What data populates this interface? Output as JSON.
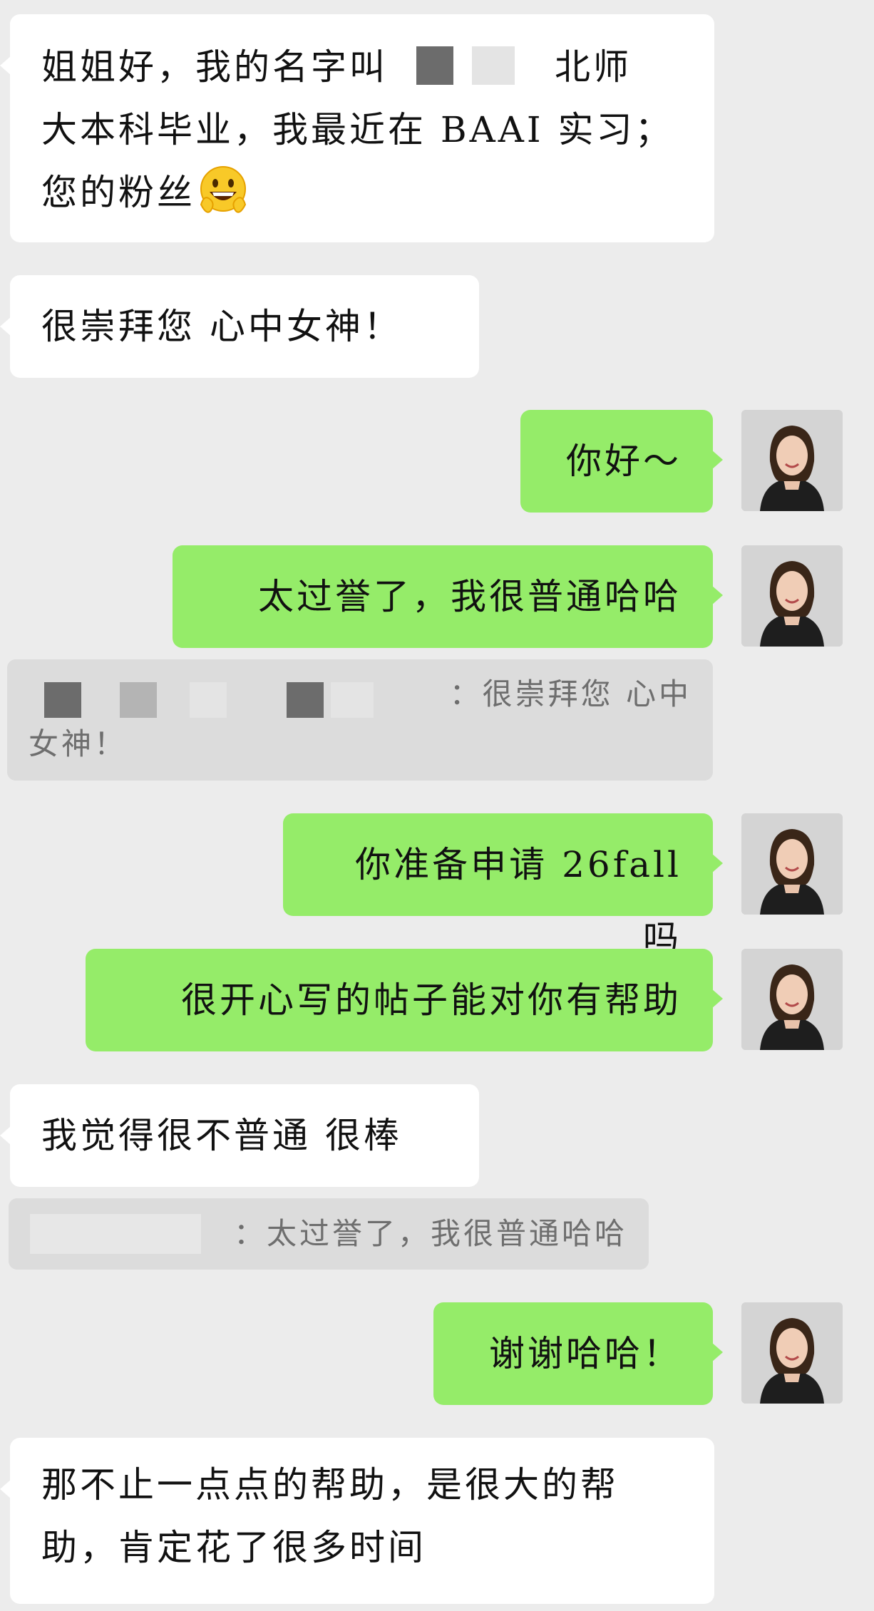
{
  "chat": {
    "messages": [
      {
        "side": "in",
        "line1_before": "姐姐好，我的名字叫",
        "line1_after": "北师",
        "line2": "大本科毕业，我最近在 BAAI 实习；",
        "line3": "您的粉丝",
        "emoji": "grinning-face-peace-hands-emoji"
      },
      {
        "side": "in",
        "text": "很崇拜您 心中女神！"
      },
      {
        "side": "out",
        "text": "你好～"
      },
      {
        "side": "out",
        "text": "太过誉了，我很普通哈哈"
      },
      {
        "side": "quote",
        "text_line1": "：很崇拜您 心中",
        "text_line2": "女神！"
      },
      {
        "side": "out",
        "text": "你准备申请 26fall 吗"
      },
      {
        "side": "out",
        "text": "很开心写的帖子能对你有帮助"
      },
      {
        "side": "in",
        "text": "我觉得很不普通 很棒"
      },
      {
        "side": "quote",
        "text": "：太过誉了，我很普通哈哈"
      },
      {
        "side": "out",
        "text": "谢谢哈哈！"
      },
      {
        "side": "in",
        "line1": "那不止一点点的帮助，是很大的帮",
        "line2": "助，肯定花了很多时间"
      }
    ]
  },
  "colors": {
    "background": "#ececec",
    "incoming_bubble": "#ffffff",
    "outgoing_bubble": "#95ec69",
    "quote_bubble": "#dcdcdc",
    "quote_text": "#6e6e6e"
  }
}
